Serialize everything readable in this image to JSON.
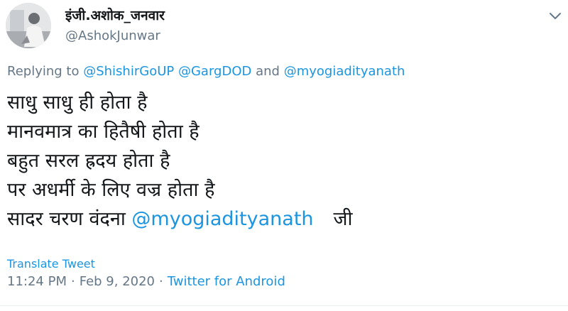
{
  "author": {
    "display_name": "इंजी.अशोक_जनवार",
    "handle": "@AshokJunwar"
  },
  "reply": {
    "prefix": "Replying to",
    "mention1": "@ShishirGoUP",
    "mention2": "@GargDOD",
    "conjunction": "and",
    "mention3": "@myogiadityanath"
  },
  "tweet": {
    "lines": [
      "साधु साधु ही होता है",
      "मानवमात्र का हितैषी होता है",
      "बहुत सरल ह्रदय होता है",
      "पर अधर्मी के लिए वज्र होता है"
    ],
    "last_line_text": "सादर चरण वंदना",
    "last_line_mention": "@myogiadityanath",
    "last_line_suffix": "जी"
  },
  "translate_label": "Translate Tweet",
  "meta": {
    "time": "11:24 PM",
    "separator": "·",
    "date": "Feb 9, 2020",
    "source": "Twitter for Android"
  },
  "icons": {
    "caret": "chevron-down-icon"
  },
  "colors": {
    "link": "#1b95e0",
    "muted": "#657786",
    "text": "#14171a"
  }
}
